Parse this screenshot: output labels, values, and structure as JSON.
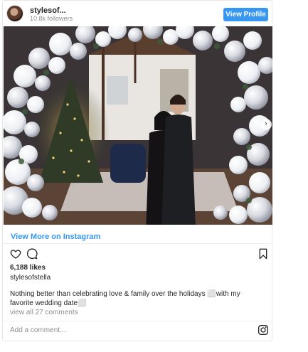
{
  "header": {
    "username": "stylesof...",
    "followers": "10.8k followers",
    "view_profile_label": "View Profile",
    "avatar_icon": "avatar"
  },
  "post": {
    "photo_description_icon": "photo",
    "carousel_next_icon": "chevron-right-icon",
    "view_more_label": "View More on Instagram",
    "likes": "6,188 likes",
    "caption_username": "stylesofstella",
    "caption_text": "Nothing better than celebrating love & family over the holidays ⬜with my favorite wedding date⬜",
    "view_comments": "view all 27 comments",
    "add_comment_placeholder": "Add a comment..."
  },
  "colors": {
    "accent": "#3897f0",
    "muted_text": "#8e8e8e",
    "border": "#e6e6e6"
  }
}
